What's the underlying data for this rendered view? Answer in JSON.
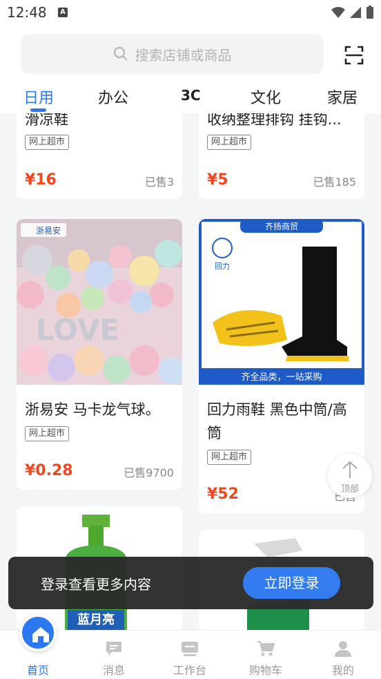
{
  "status": {
    "time": "12:48",
    "notification_letter": "A"
  },
  "search": {
    "placeholder": "搜索店铺或商品"
  },
  "tabs": [
    {
      "label": "日用"
    },
    {
      "label": "办公"
    },
    {
      "label": "3C"
    },
    {
      "label": "文化"
    },
    {
      "label": "家居"
    }
  ],
  "products": [
    {
      "title": "滑凉鞋",
      "badge": "网上超市",
      "price": "¥16",
      "sold": "已售3"
    },
    {
      "title": "收纳整理排钩 挂钩...",
      "badge": "网上超市",
      "price": "¥5",
      "sold": "已售185"
    },
    {
      "title": "浙易安 马卡龙气球。",
      "badge": "网上超市",
      "price": "¥0.28",
      "sold": "已售9700",
      "image_brand": "浙易安"
    },
    {
      "title": "回力雨鞋 黑色中筒/高筒",
      "badge": "网上超市",
      "price": "¥52",
      "sold": "已售",
      "image_banner_top": "齐扬商贸",
      "image_banner_bottom": "齐全品类，一站采购",
      "image_brand": "回力"
    },
    {
      "image_brand": "蓝月亮"
    },
    {
      "image_brand": ""
    }
  ],
  "back_to_top": {
    "label": "顶部"
  },
  "login_toast": {
    "message": "登录查看更多内容",
    "button": "立即登录"
  },
  "bottom_nav": [
    {
      "label": "首页",
      "icon": "home-icon"
    },
    {
      "label": "消息",
      "icon": "message-icon"
    },
    {
      "label": "工作台",
      "icon": "workbench-icon"
    },
    {
      "label": "购物车",
      "icon": "cart-icon"
    },
    {
      "label": "我的",
      "icon": "profile-icon"
    }
  ],
  "colors": {
    "accent": "#2b78f0",
    "price": "#f0471f",
    "toast_bg": "#2b2b2b"
  }
}
